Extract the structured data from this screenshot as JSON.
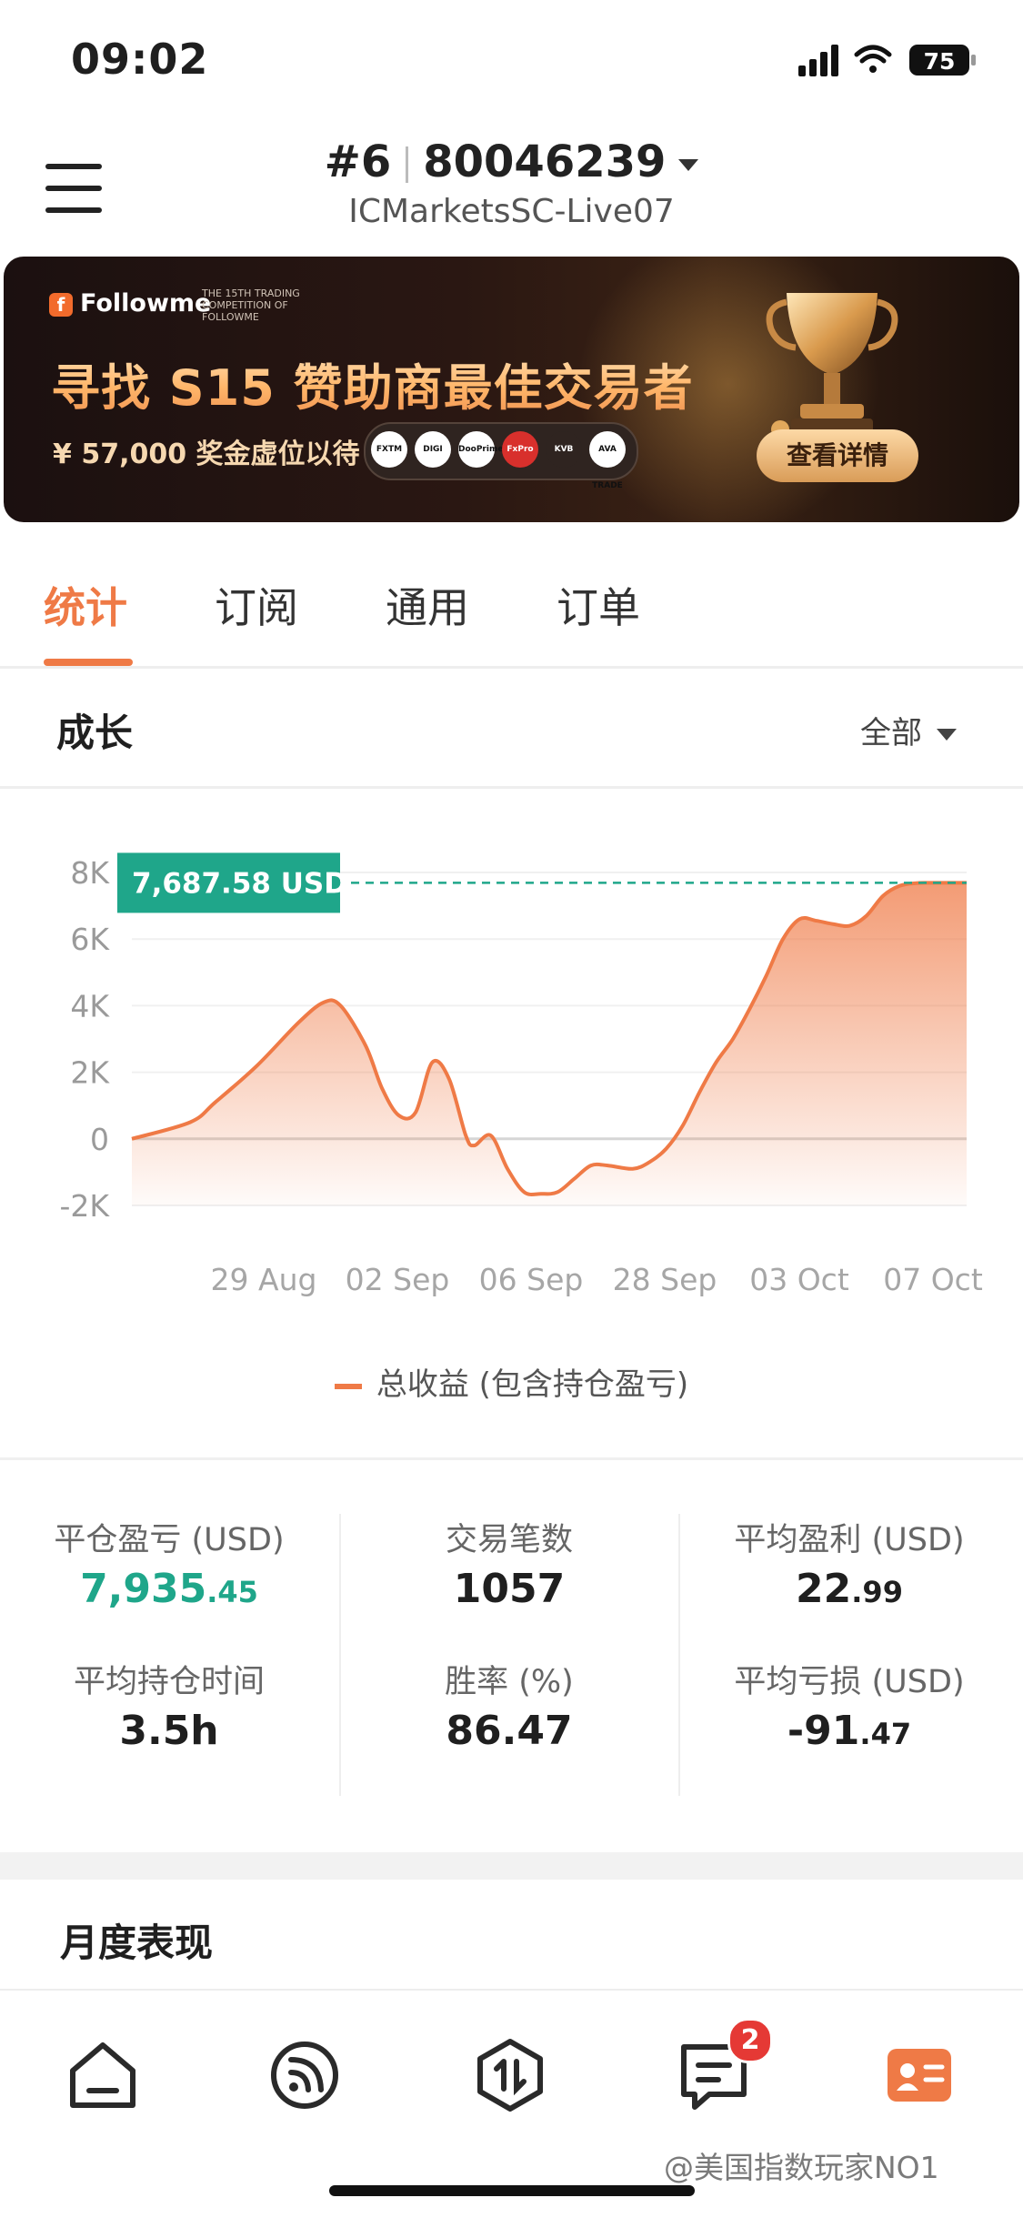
{
  "status_bar": {
    "time": "09:02",
    "battery": "75",
    "icons": [
      "signal-icon",
      "wifi-icon",
      "battery-icon"
    ]
  },
  "header": {
    "rank": "#6",
    "account_number": "80046239",
    "server": "ICMarketsSC-Live07"
  },
  "banner": {
    "brand": "Followme",
    "competition_line": "THE 15TH TRADING COMPETITION OF FOLLOWME",
    "title": "寻找 S15 赞助商最佳交易者",
    "subtitle": "¥ 57,000 奖金虚位以待",
    "sponsors": [
      "FXTM",
      "DIGI",
      "DooPrime",
      "FxPro",
      "KVB",
      "AVA TRADE"
    ],
    "cta": "查看详情"
  },
  "tabs": [
    {
      "label": "统计",
      "active": true
    },
    {
      "label": "订阅",
      "active": false
    },
    {
      "label": "通用",
      "active": false
    },
    {
      "label": "订单",
      "active": false
    }
  ],
  "growth": {
    "title": "成长",
    "filter": "全部"
  },
  "chart_data": {
    "type": "area",
    "title": "",
    "xlabel": "",
    "ylabel": "",
    "ylim": [
      -2000,
      8000
    ],
    "y_ticks": [
      "8K",
      "6K",
      "4K",
      "2K",
      "0",
      "-2K"
    ],
    "x_ticks": [
      "29 Aug",
      "02 Sep",
      "06 Sep",
      "28 Sep",
      "03 Oct",
      "07 Oct"
    ],
    "current_value_label": "7,687.58 USD",
    "series": [
      {
        "name": "总收益 (包含持仓盈亏)",
        "color": "#ef7a46",
        "x": [
          0,
          0.07,
          0.1,
          0.15,
          0.2,
          0.23,
          0.25,
          0.28,
          0.3,
          0.32,
          0.34,
          0.36,
          0.38,
          0.4,
          0.41,
          0.43,
          0.45,
          0.47,
          0.49,
          0.51,
          0.53,
          0.55,
          0.57,
          0.6,
          0.62,
          0.64,
          0.66,
          0.68,
          0.7,
          0.72,
          0.74,
          0.76,
          0.78,
          0.8,
          0.82,
          0.84,
          0.86,
          0.88,
          0.9,
          0.92,
          0.94,
          0.96,
          0.98,
          1.0
        ],
        "values": [
          0,
          500,
          1100,
          2200,
          3500,
          4100,
          4000,
          2800,
          1500,
          700,
          800,
          2300,
          1800,
          100,
          -200,
          100,
          -900,
          -1600,
          -1650,
          -1600,
          -1200,
          -800,
          -800,
          -900,
          -700,
          -300,
          400,
          1400,
          2300,
          3000,
          3900,
          4900,
          6000,
          6600,
          6550,
          6450,
          6400,
          6700,
          7300,
          7600,
          7680,
          7690,
          7690,
          7688
        ]
      }
    ],
    "legend": "bottom"
  },
  "stats": [
    {
      "label": "平仓盈亏 (USD)",
      "int": "7,935",
      "dec": ".45",
      "green": true
    },
    {
      "label": "交易笔数",
      "int": "1057",
      "dec": "",
      "green": false
    },
    {
      "label": "平均盈利 (USD)",
      "int": "22",
      "dec": ".99",
      "green": false
    },
    {
      "label": "平均持仓时间",
      "int": "3.5h",
      "dec": "",
      "green": false
    },
    {
      "label": "胜率 (%)",
      "int": "86.47",
      "dec": "",
      "green": false
    },
    {
      "label": "平均亏损 (USD)",
      "int": "-91",
      "dec": ".47",
      "green": false
    }
  ],
  "monthly": {
    "title": "月度表现"
  },
  "bottom_nav": {
    "items": [
      "home-icon",
      "feed-icon",
      "trade-icon",
      "messages-icon",
      "account-icon"
    ],
    "messages_badge": "2"
  },
  "watermark": "@美国指数玩家NO1"
}
